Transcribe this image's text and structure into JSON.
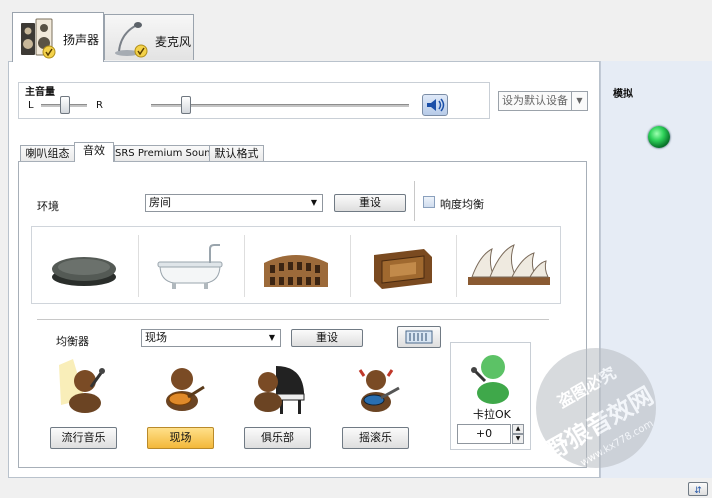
{
  "device_tabs": [
    {
      "label": "扬声器",
      "icon": "speaker-icon",
      "active": true
    },
    {
      "label": "麦克风",
      "icon": "microphone-icon",
      "active": false
    }
  ],
  "volume": {
    "title": "主音量",
    "left_label": "L",
    "right_label": "R",
    "balance_value": 0.5,
    "level_value": 0.14,
    "mute_icon": "speaker-volume-icon",
    "default_device": "设为默认设备"
  },
  "sub_tabs": [
    "喇叭组态",
    "音效",
    "SRS Premium Sound",
    "默认格式"
  ],
  "environment": {
    "label": "环境",
    "selected": "房间",
    "reset_label": "重设",
    "loudness_label": "响度均衡",
    "loudness_checked": false,
    "presets": [
      {
        "icon": "stone-disc-icon"
      },
      {
        "icon": "bathtub-icon"
      },
      {
        "icon": "colosseum-icon"
      },
      {
        "icon": "wooden-box-icon"
      },
      {
        "icon": "opera-house-icon"
      }
    ]
  },
  "equalizer": {
    "label": "均衡器",
    "selected": "现场",
    "reset_label": "重设",
    "graphic_eq_icon": "graphic-eq-icon",
    "presets": [
      {
        "label": "流行音乐",
        "icon": "singer-icon",
        "active": false
      },
      {
        "label": "现场",
        "icon": "guitarist-icon",
        "active": true
      },
      {
        "label": "俱乐部",
        "icon": "pianist-icon",
        "active": false
      },
      {
        "label": "摇滚乐",
        "icon": "rock-guitarist-icon",
        "active": false
      }
    ]
  },
  "karaoke": {
    "label": "卡拉OK",
    "icon": "karaoke-singer-icon",
    "value": "+0"
  },
  "side_panel": {
    "title": "模拟",
    "indicator_color": "#1fbf4a"
  },
  "watermark": {
    "line1": "盗图必究",
    "line2": "野狼音效网",
    "url": "www.kx778.com"
  },
  "colors": {
    "side_panel_bg": "#e6ecf5",
    "active_preset_button": "#f6c74a"
  }
}
